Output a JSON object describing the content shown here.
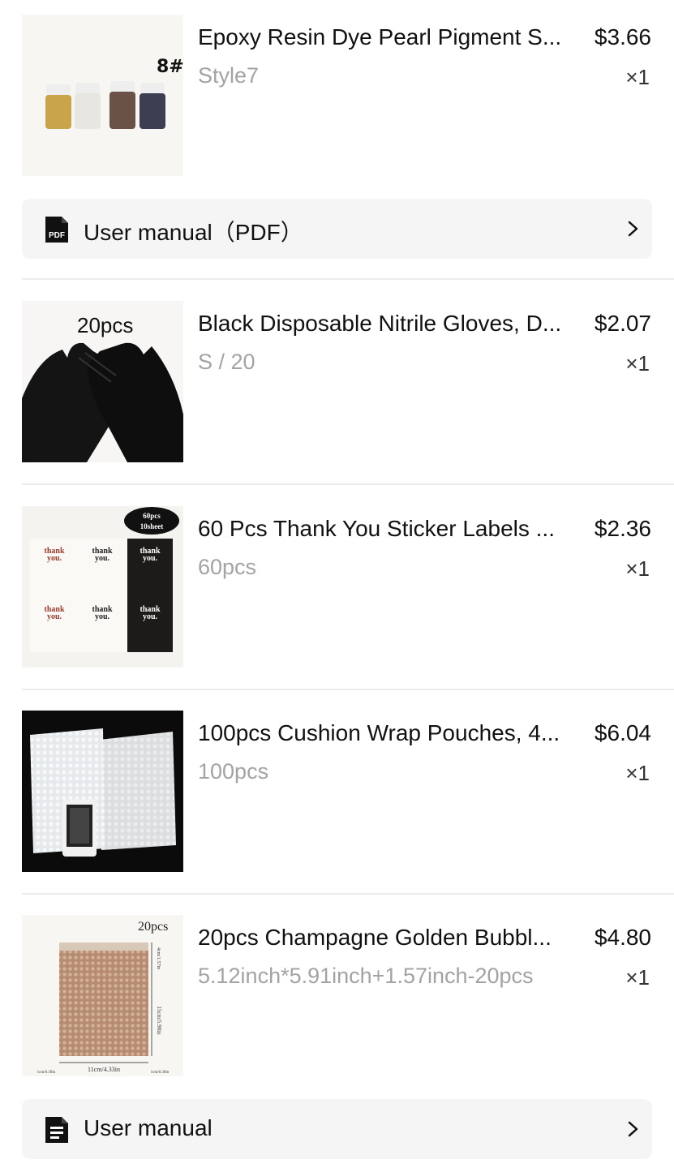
{
  "items": [
    {
      "title": "Epoxy Resin Dye Pearl Pigment S...",
      "price": "$3.66",
      "variant": "Style7",
      "qty": "×1",
      "image_label": "8#"
    },
    {
      "title": "Black Disposable Nitrile Gloves, D...",
      "price": "$2.07",
      "variant": "S / 20",
      "qty": "×1",
      "image_label": "20pcs"
    },
    {
      "title": "60 Pcs Thank You Sticker Labels ...",
      "price": "$2.36",
      "variant": "60pcs",
      "qty": "×1",
      "image_badge_top": "60pcs",
      "image_badge_bottom": "10sheet",
      "sticker_text_1": "thank",
      "sticker_text_2": "you."
    },
    {
      "title": "100pcs Cushion Wrap Pouches, 4...",
      "price": "$6.04",
      "variant": "100pcs",
      "qty": "×1"
    },
    {
      "title": "20pcs Champagne Golden Bubbl...",
      "price": "$4.80",
      "variant": "5.12inch*5.91inch+1.57inch-20pcs",
      "qty": "×1",
      "image_label": "20pcs",
      "dim_width": "11cm/4.33in",
      "dim_height": "15cm/5.90in",
      "dim_flap": "4cm/1.57in",
      "dim_side": "1cm/0.39in"
    }
  ],
  "manuals": [
    {
      "label": "User manual（PDF）",
      "icon_text": "PDF",
      "icon": "pdf-file-icon"
    },
    {
      "label": "User manual",
      "icon": "document-icon"
    }
  ],
  "colors": {
    "secondary_text": "#a3a3a3",
    "manual_bg": "#f5f5f5",
    "divider": "#ececec"
  }
}
